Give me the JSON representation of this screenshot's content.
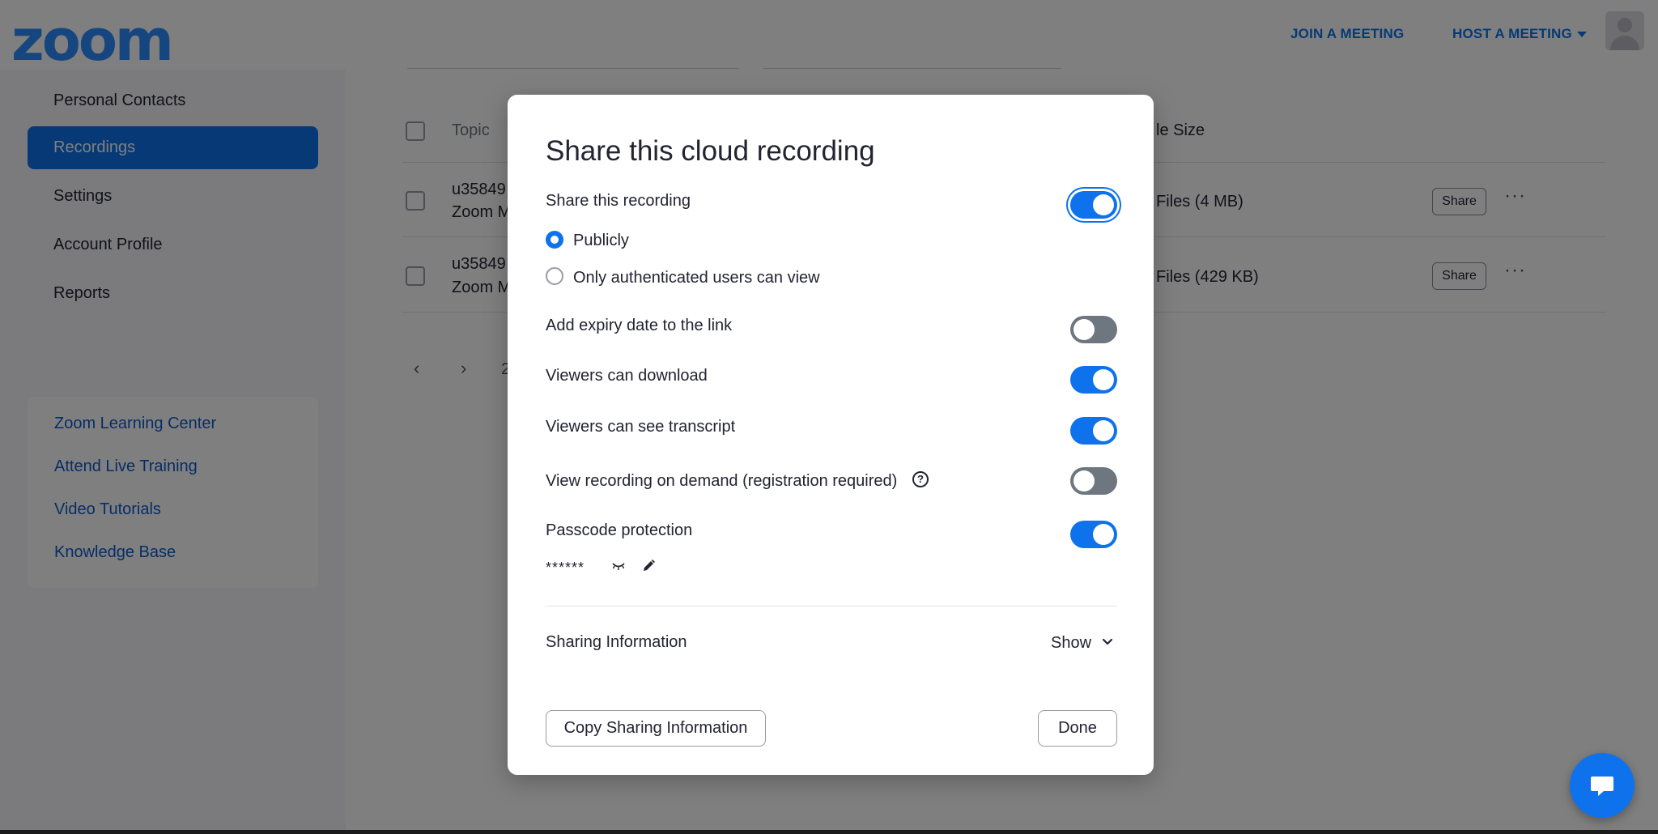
{
  "header": {
    "logo": "zoom",
    "join_label": "JOIN A MEETING",
    "host_label": "HOST A MEETING"
  },
  "sidebar": {
    "items": [
      {
        "label": "Personal Contacts"
      },
      {
        "label": "Recordings"
      },
      {
        "label": "Settings"
      },
      {
        "label": "Account Profile"
      },
      {
        "label": "Reports"
      }
    ],
    "help_links": [
      {
        "label": "Zoom Learning Center"
      },
      {
        "label": "Attend Live Training"
      },
      {
        "label": "Video Tutorials"
      },
      {
        "label": "Knowledge Base"
      }
    ]
  },
  "table": {
    "headers": {
      "topic": "Topic",
      "size": "le Size"
    },
    "rows": [
      {
        "topic": "u35849",
        "sub": "Zoom M",
        "size": "Files (4 MB)",
        "share": "Share",
        "more": "···"
      },
      {
        "topic": "u35849",
        "sub": "Zoom M",
        "size": "Files (429 KB)",
        "share": "Share",
        "more": "···"
      }
    ],
    "pager": {
      "prev": "‹",
      "next": "›",
      "page": "2"
    }
  },
  "dialog": {
    "title": "Share this cloud recording",
    "share_label": "Share this recording",
    "share_on": true,
    "radio_public": "Publicly",
    "radio_auth": "Only authenticated users can view",
    "expiry_label": "Add expiry date to the link",
    "expiry_on": false,
    "download_label": "Viewers can download",
    "download_on": true,
    "transcript_label": "Viewers can see transcript",
    "transcript_on": true,
    "ondemand_label": "View recording on demand (registration required)",
    "ondemand_on": false,
    "help_glyph": "?",
    "passcode_label": "Passcode protection",
    "passcode_on": true,
    "passcode_value": "******",
    "sharing_info_label": "Sharing Information",
    "show_label": "Show",
    "copy_button": "Copy Sharing Information",
    "done_button": "Done"
  },
  "colors": {
    "accent": "#0e72ed",
    "toggle_off": "#6e7680",
    "text": "#232333"
  }
}
